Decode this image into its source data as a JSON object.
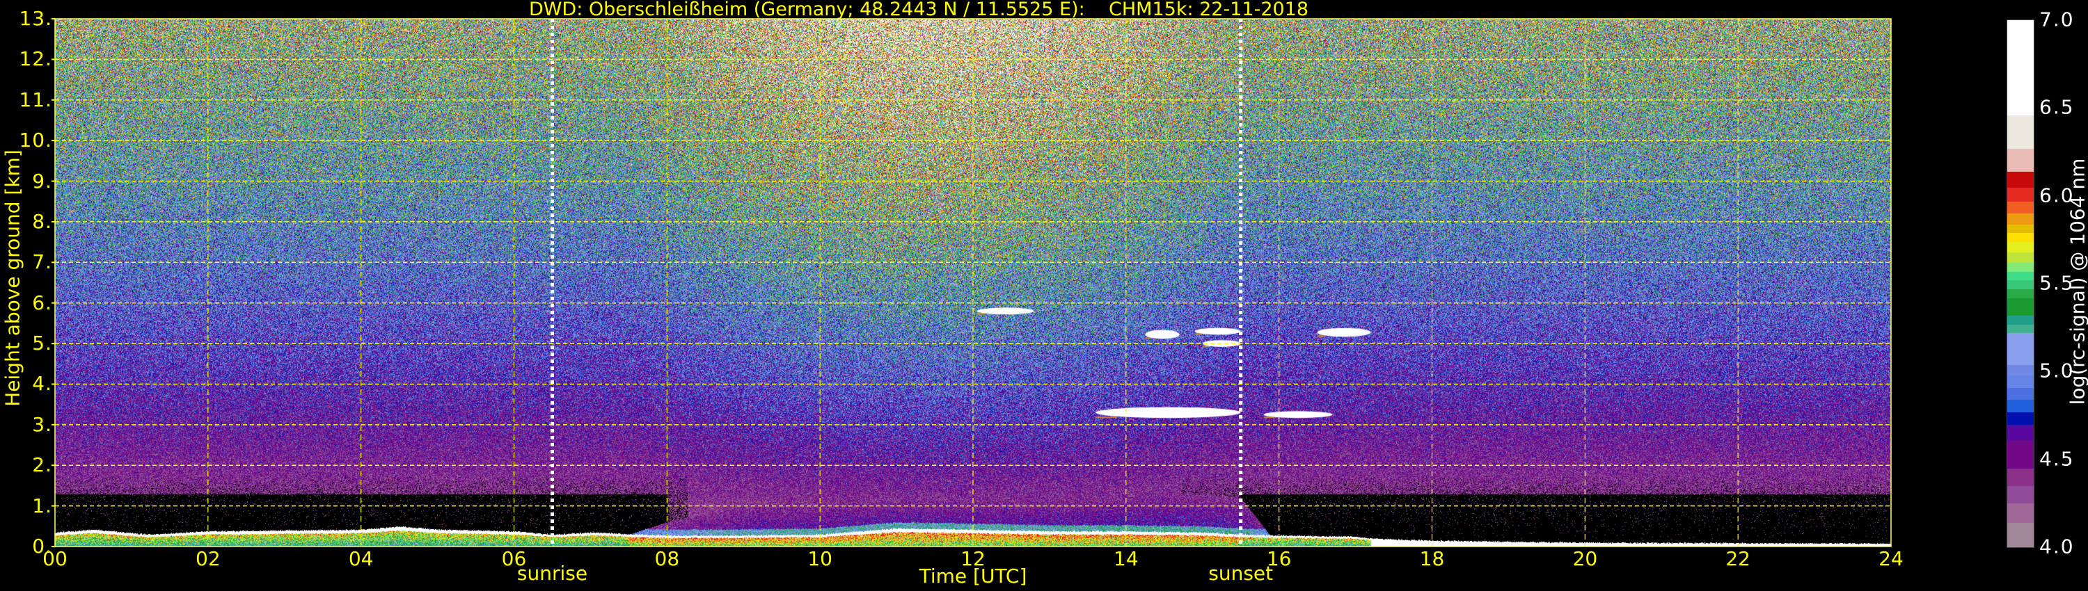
{
  "chart_data": {
    "type": "heatmap",
    "title": "DWD: Oberschleißheim (Germany; 48.2443 N / 11.5525 E):    CHM15k: 22-11-2018",
    "xlabel": "Time [UTC]",
    "ylabel": "Height above ground [km]",
    "xlim": [
      0,
      24
    ],
    "ylim": [
      0,
      13
    ],
    "xticks": [
      "00",
      "02",
      "04",
      "06",
      "08",
      "10",
      "12",
      "14",
      "16",
      "18",
      "20",
      "22",
      "24"
    ],
    "xtick_values": [
      0,
      2,
      4,
      6,
      8,
      10,
      12,
      14,
      16,
      18,
      20,
      22,
      24
    ],
    "yticks": [
      "0.",
      "1.",
      "2.",
      "3.",
      "4.",
      "5.",
      "6.",
      "7.",
      "8.",
      "9.",
      "10.",
      "11.",
      "12.",
      "13."
    ],
    "ytick_values": [
      0,
      1,
      2,
      3,
      4,
      5,
      6,
      7,
      8,
      9,
      10,
      11,
      12,
      13
    ],
    "grid": true,
    "annotations": [
      {
        "label": "sunrise",
        "time": 6.5
      },
      {
        "label": "sunset",
        "time": 15.5
      }
    ],
    "colorbar": {
      "label": "log(rc-signal) @ 1064 nm",
      "range": [
        4.0,
        7.0
      ],
      "ticks": [
        "4.0",
        "4.5",
        "5.0",
        "5.5",
        "6.0",
        "6.5",
        "7.0"
      ],
      "tick_values": [
        4.0,
        4.5,
        5.0,
        5.5,
        6.0,
        6.5,
        7.0
      ],
      "bands": [
        {
          "from": 4.0,
          "color": "#a08898"
        },
        {
          "from": 4.14,
          "color": "#a06898"
        },
        {
          "from": 4.25,
          "color": "#904c98"
        },
        {
          "from": 4.35,
          "color": "#8a3088"
        },
        {
          "from": 4.45,
          "color": "#700888"
        },
        {
          "from": 4.61,
          "color": "#5808a0"
        },
        {
          "from": 4.7,
          "color": "#0010b0"
        },
        {
          "from": 4.77,
          "color": "#2060dc"
        },
        {
          "from": 4.84,
          "color": "#4c70e0"
        },
        {
          "from": 4.91,
          "color": "#6484e8"
        },
        {
          "from": 4.98,
          "color": "#7088e4"
        },
        {
          "from": 5.04,
          "color": "#8aa0ee"
        },
        {
          "from": 5.22,
          "color": "#40b090"
        },
        {
          "from": 5.27,
          "color": "#20a08a"
        },
        {
          "from": 5.32,
          "color": "#1a9a30"
        },
        {
          "from": 5.42,
          "color": "#2aaa46"
        },
        {
          "from": 5.47,
          "color": "#38c878"
        },
        {
          "from": 5.52,
          "color": "#40dc88"
        },
        {
          "from": 5.57,
          "color": "#80ea7c"
        },
        {
          "from": 5.62,
          "color": "#c0e43a"
        },
        {
          "from": 5.68,
          "color": "#e4ef20"
        },
        {
          "from": 5.74,
          "color": "#ffe000"
        },
        {
          "from": 5.79,
          "color": "#e6be00"
        },
        {
          "from": 5.84,
          "color": "#ec9a10"
        },
        {
          "from": 5.9,
          "color": "#f06022"
        },
        {
          "from": 5.97,
          "color": "#e52a21"
        },
        {
          "from": 6.05,
          "color": "#c80a0a"
        },
        {
          "from": 6.14,
          "color": "#e8bdb6"
        },
        {
          "from": 6.27,
          "color": "#ece8df"
        },
        {
          "from": 6.46,
          "color": "#ffffff"
        }
      ]
    },
    "boundary_layer_top_km": {
      "time": [
        0,
        0.5,
        1.2,
        2,
        3,
        4,
        4.5,
        5,
        6,
        6.5,
        7,
        8,
        9,
        10,
        11,
        12,
        13,
        14,
        15,
        15.5,
        16,
        17,
        17.2,
        18,
        20,
        24
      ],
      "height": [
        0.35,
        0.42,
        0.3,
        0.38,
        0.4,
        0.42,
        0.5,
        0.42,
        0.38,
        0.3,
        0.35,
        0.27,
        0.28,
        0.3,
        0.45,
        0.42,
        0.38,
        0.38,
        0.35,
        0.3,
        0.28,
        0.25,
        0.2,
        0.15,
        0.1,
        0.08
      ]
    },
    "aerosol_layer_top_km": {
      "time": [
        0,
        7,
        8,
        9,
        10,
        11,
        12,
        13,
        14,
        15,
        15.5,
        16,
        24
      ],
      "height": [
        0,
        0,
        0.6,
        1.0,
        1.1,
        1.2,
        1.2,
        1.2,
        1.3,
        1.3,
        1.2,
        0,
        0
      ]
    },
    "cloud_layers": [
      {
        "t_start": 12.05,
        "t_end": 12.8,
        "base_km": 5.75,
        "top_km": 5.85
      },
      {
        "t_start": 13.6,
        "t_end": 15.5,
        "base_km": 3.2,
        "top_km": 3.4
      },
      {
        "t_start": 14.25,
        "t_end": 14.7,
        "base_km": 5.15,
        "top_km": 5.3
      },
      {
        "t_start": 14.9,
        "t_end": 15.5,
        "base_km": 5.25,
        "top_km": 5.35
      },
      {
        "t_start": 15.0,
        "t_end": 15.5,
        "base_km": 4.95,
        "top_km": 5.05
      },
      {
        "t_start": 16.5,
        "t_end": 17.2,
        "base_km": 5.2,
        "top_km": 5.35
      },
      {
        "t_start": 15.8,
        "t_end": 16.7,
        "base_km": 3.2,
        "top_km": 3.3
      }
    ],
    "text_color": "#ffff00"
  }
}
